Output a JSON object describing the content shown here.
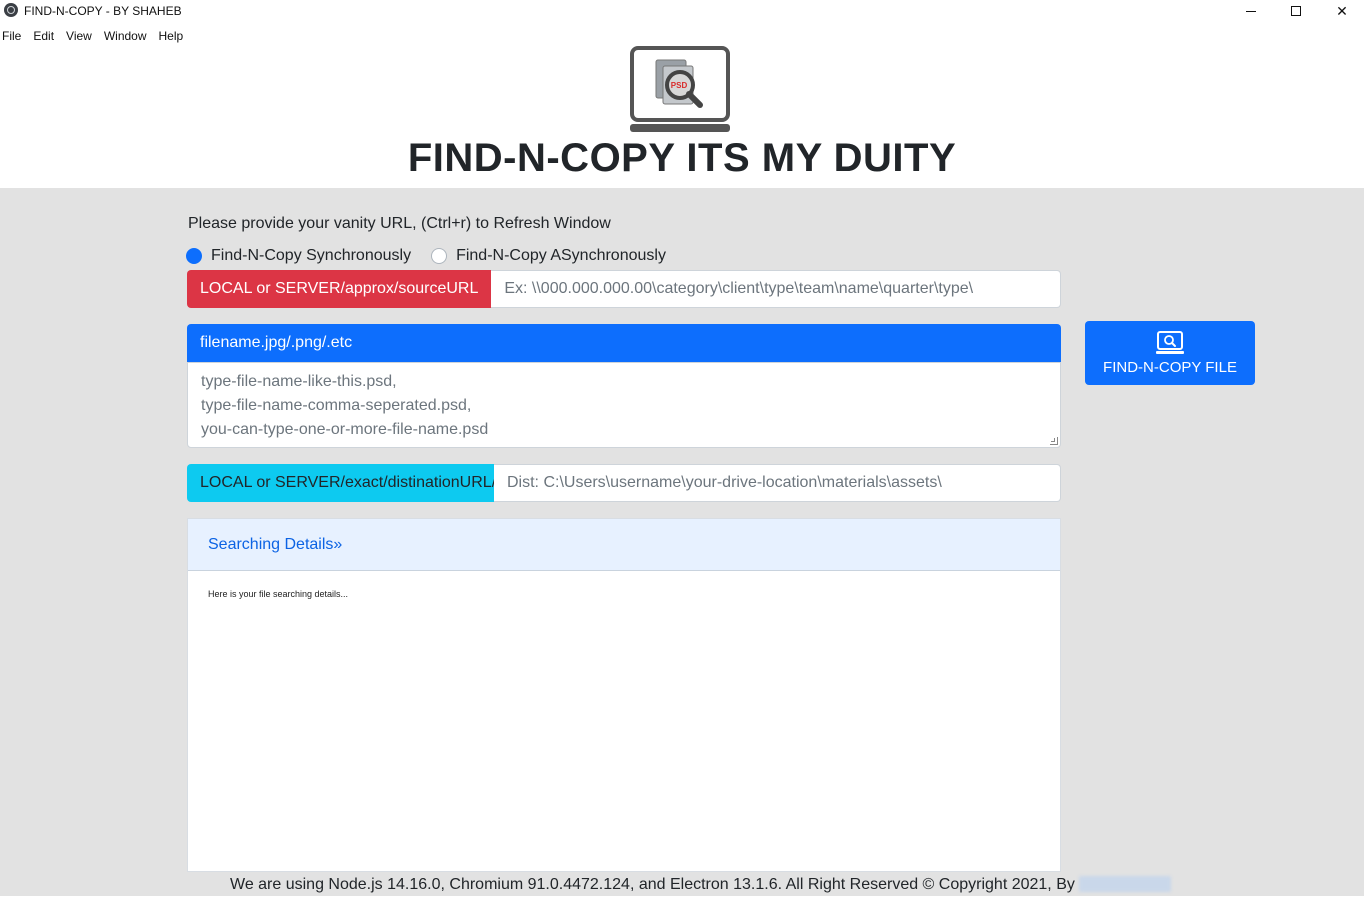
{
  "window": {
    "title": "FIND-N-COPY - BY SHAHEB"
  },
  "menu": [
    "File",
    "Edit",
    "View",
    "Window",
    "Help"
  ],
  "hero": {
    "logo_badge": "PSD",
    "title": "FIND-N-COPY ITS MY DUITY"
  },
  "form": {
    "prompt": "Please provide your vanity URL, (Ctrl+r) to Refresh Window",
    "radio_sync": {
      "label": "Find-N-Copy Synchronously",
      "checked": true
    },
    "radio_async": {
      "label": "Find-N-Copy ASynchronously",
      "checked": false
    },
    "source": {
      "label": "LOCAL or SERVER/approx/sourceURL",
      "placeholder": "Ex: \\\\000.000.000.00\\category\\client\\type\\team\\name\\quarter\\type\\"
    },
    "filename": {
      "label": "filename.jpg/.png/.etc",
      "placeholder_lines": [
        "type-file-name-like-this.psd,",
        "type-file-name-comma-seperated.psd,",
        "you-can-type-one-or-more-file-name.psd"
      ]
    },
    "destination": {
      "label": "LOCAL or SERVER/exact/distinationURL/",
      "placeholder": "Dist: C:\\Users\\username\\your-drive-location\\materials\\assets\\"
    },
    "find_button": {
      "label": "FIND-N-COPY FILE",
      "icon": "laptop-search-icon"
    }
  },
  "details": {
    "header": "Searching Details»",
    "body": "Here is your file searching details..."
  },
  "footer": {
    "text": "We are using Node.js 14.16.0, Chromium 91.0.4472.124, and Electron 13.1.6. All Right Reserved © Copyright 2021, By"
  },
  "colors": {
    "primary": "#0d6efd",
    "danger": "#dc3545",
    "info": "#0dcaf0",
    "background": "#e2e2e2"
  }
}
